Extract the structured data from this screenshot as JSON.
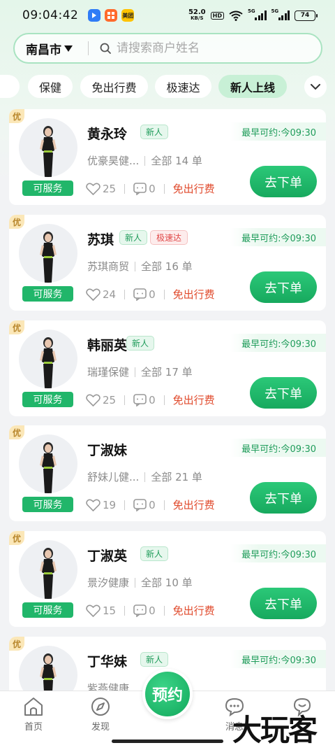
{
  "status_bar": {
    "time": "09:04:42",
    "apps": [
      {
        "name": "app-blue-icon",
        "color": "#2f7cf6",
        "label": ""
      },
      {
        "name": "app-orange-icon",
        "color": "#ff6a2b",
        "label": ""
      },
      {
        "name": "meituan-icon",
        "color": "#ffc300",
        "label": "美团"
      }
    ],
    "net_speed": "52.0",
    "net_unit": "KB/S",
    "hd": "HD",
    "signal_label": "5G",
    "battery": "74"
  },
  "search": {
    "city": "南昌市",
    "placeholder": "请搜索商户姓名"
  },
  "filters": [
    "保健",
    "免出行费",
    "极速达",
    "新人上线"
  ],
  "active_filter": "新人上线",
  "cards": [
    {
      "name": "黄永玲",
      "tags": [
        "新人"
      ],
      "earliest": "最早可约:今09:30",
      "shop": "优豪昊健...",
      "orders": "全部 14 单",
      "likes": "25",
      "comments": "0",
      "fee": "免出行费",
      "status": "可服务",
      "button": "去下单"
    },
    {
      "name": "苏琪",
      "tags": [
        "新人",
        "极速达"
      ],
      "earliest": "最早可约:今09:30",
      "shop": "苏琪商贸",
      "orders": "全部 16 单",
      "likes": "24",
      "comments": "0",
      "fee": "免出行费",
      "status": "可服务",
      "button": "去下单"
    },
    {
      "name": "韩丽英",
      "tags": [
        "新人"
      ],
      "earliest": "最早可约:今09:30",
      "shop": "瑞瑾保健",
      "orders": "全部 17 单",
      "likes": "25",
      "comments": "0",
      "fee": "免出行费",
      "status": "可服务",
      "button": "去下单"
    },
    {
      "name": "丁淑妹",
      "tags": [],
      "earliest": "最早可约:今09:30",
      "shop": "舒妹儿健...",
      "orders": "全部 21 单",
      "likes": "19",
      "comments": "0",
      "fee": "免出行费",
      "status": "可服务",
      "button": "去下单"
    },
    {
      "name": "丁淑英",
      "tags": [
        "新人"
      ],
      "earliest": "最早可约:今09:30",
      "shop": "景汐健康",
      "orders": "全部 10 单",
      "likes": "15",
      "comments": "0",
      "fee": "免出行费",
      "status": "可服务",
      "button": "去下单"
    },
    {
      "name": "丁华妹",
      "tags": [
        "新人"
      ],
      "earliest": "最早可约:今09:30",
      "shop": "紫燕健康",
      "orders": "",
      "likes": "",
      "comments": "",
      "fee": "",
      "status": "",
      "button": ""
    }
  ],
  "you_tag": "优",
  "nav": {
    "home": "首页",
    "discover": "发现",
    "reserve": "预约",
    "messages": "消息",
    "watermark": "大玩客"
  },
  "colors": {
    "accent": "#21b66a",
    "fee_red": "#e04a2c",
    "tag_green": "#1f9c5a"
  }
}
